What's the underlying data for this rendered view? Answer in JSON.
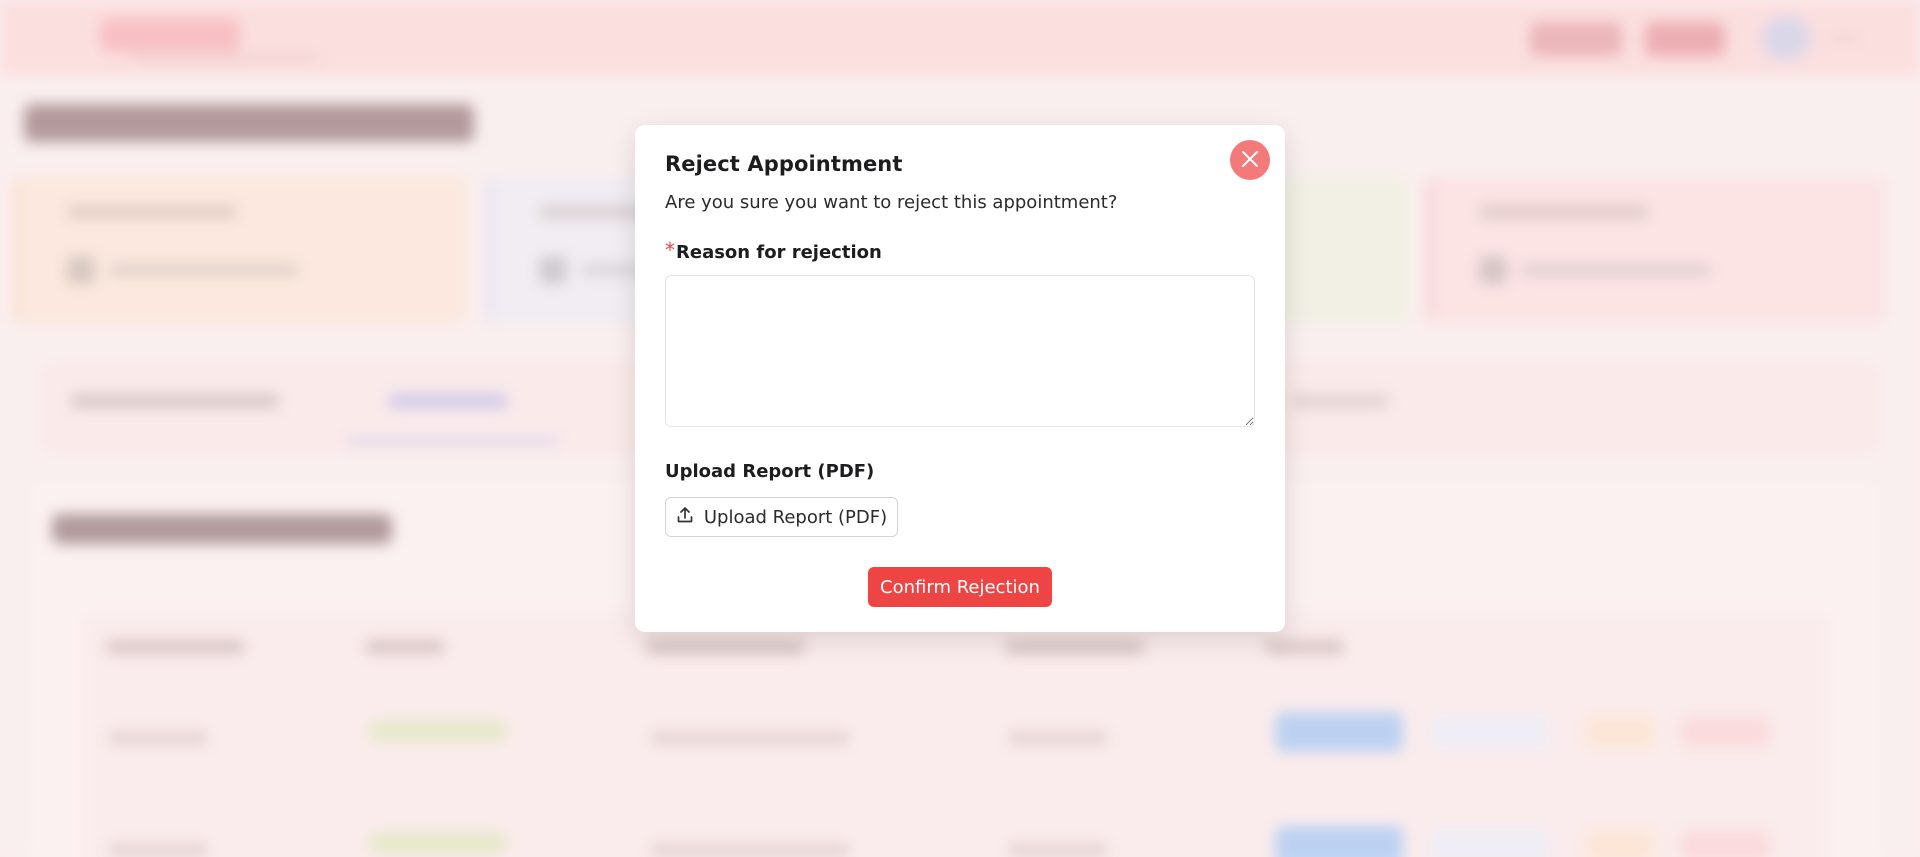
{
  "modal": {
    "title": "Reject Appointment",
    "description": "Are you sure you want to reject this appointment?",
    "reason_label": "Reason for rejection",
    "required_marker": "*",
    "reason_value": "",
    "upload_label": "Upload Report (PDF)",
    "upload_button_label": "Upload Report (PDF)",
    "confirm_button_label": "Confirm Rejection",
    "close_icon": "close-icon",
    "upload_icon": "upload-icon"
  },
  "colors": {
    "accent_red": "#ef4444",
    "close_button": "#f47a7a",
    "modal_background": "#ffffff"
  }
}
